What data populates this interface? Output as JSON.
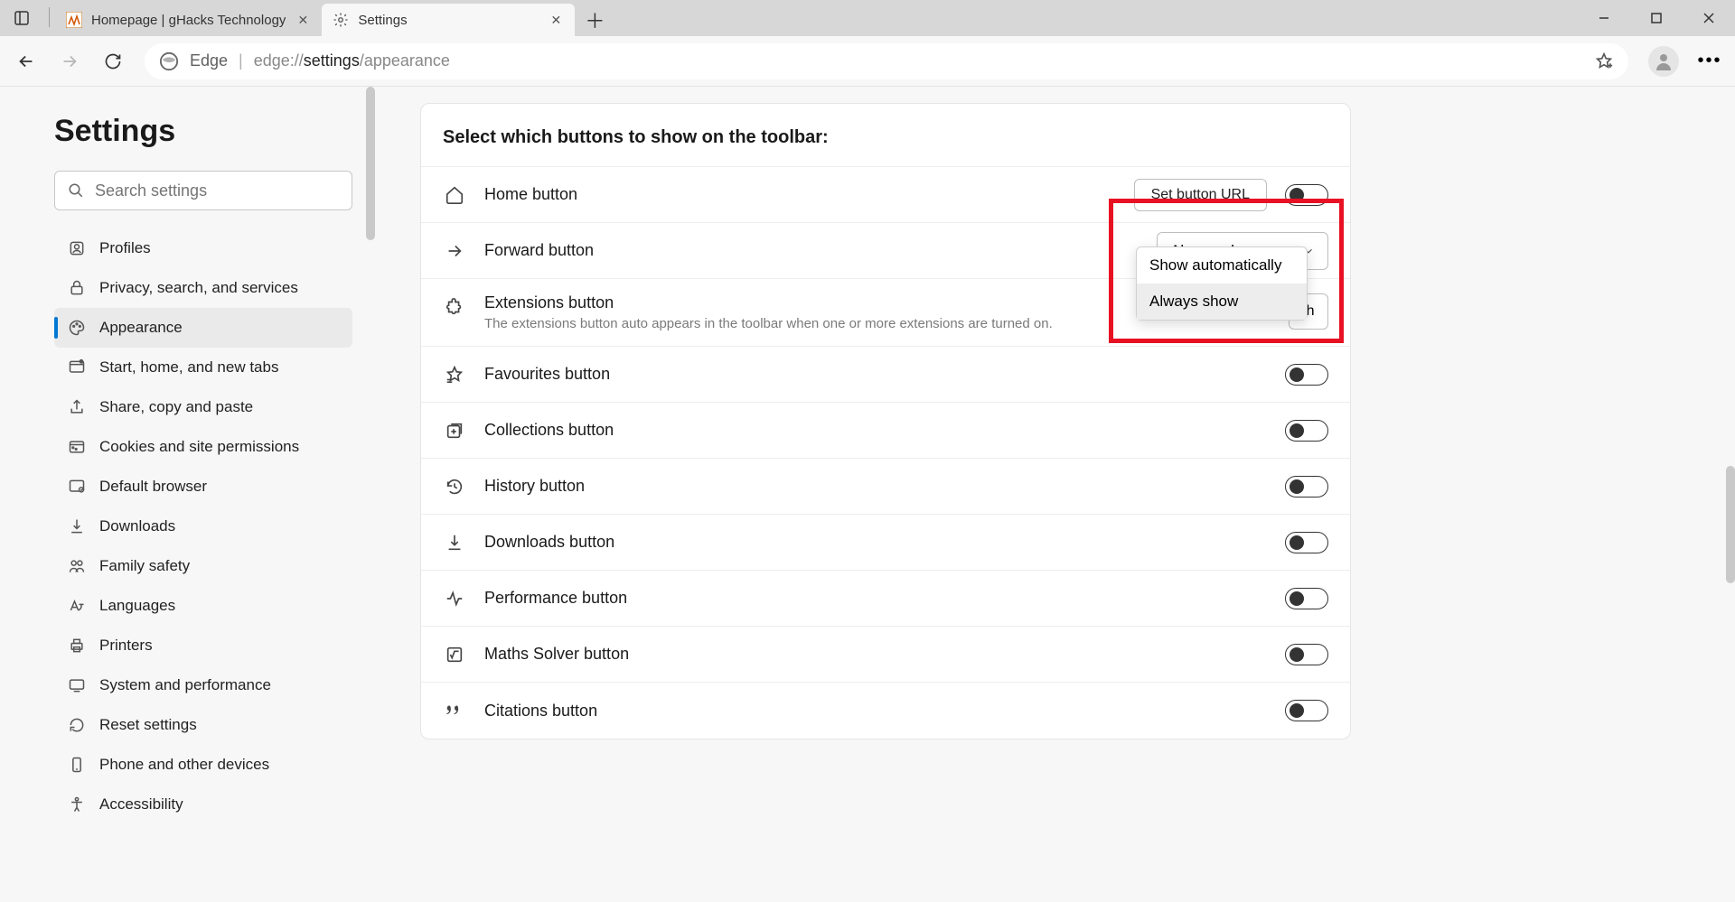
{
  "titlebar": {
    "tabs": [
      {
        "title": "Homepage | gHacks Technology"
      },
      {
        "title": "Settings"
      }
    ]
  },
  "addressbar": {
    "prefix": "Edge",
    "url_dim1": "edge://",
    "url_strong": "settings",
    "url_dim2": "/appearance"
  },
  "sidebar": {
    "title": "Settings",
    "search_placeholder": "Search settings",
    "items": [
      {
        "label": "Profiles"
      },
      {
        "label": "Privacy, search, and services"
      },
      {
        "label": "Appearance"
      },
      {
        "label": "Start, home, and new tabs"
      },
      {
        "label": "Share, copy and paste"
      },
      {
        "label": "Cookies and site permissions"
      },
      {
        "label": "Default browser"
      },
      {
        "label": "Downloads"
      },
      {
        "label": "Family safety"
      },
      {
        "label": "Languages"
      },
      {
        "label": "Printers"
      },
      {
        "label": "System and performance"
      },
      {
        "label": "Reset settings"
      },
      {
        "label": "Phone and other devices"
      },
      {
        "label": "Accessibility"
      }
    ]
  },
  "panel": {
    "header": "Select which buttons to show on the toolbar:",
    "rows": {
      "home": {
        "title": "Home button",
        "btn": "Set button URL"
      },
      "forward": {
        "title": "Forward button",
        "dropdown": "Always show"
      },
      "extensions": {
        "title": "Extensions button",
        "sub": "The extensions button auto appears in the toolbar when one or more extensions are turned on.",
        "btn_clip": "Sh"
      },
      "favourites": {
        "title": "Favourites button"
      },
      "collections": {
        "title": "Collections button"
      },
      "history": {
        "title": "History button"
      },
      "downloads": {
        "title": "Downloads button"
      },
      "performance": {
        "title": "Performance button"
      },
      "maths": {
        "title": "Maths Solver button"
      },
      "citations": {
        "title": "Citations button"
      }
    }
  },
  "popup": {
    "opt1": "Show automatically",
    "opt2": "Always show"
  }
}
